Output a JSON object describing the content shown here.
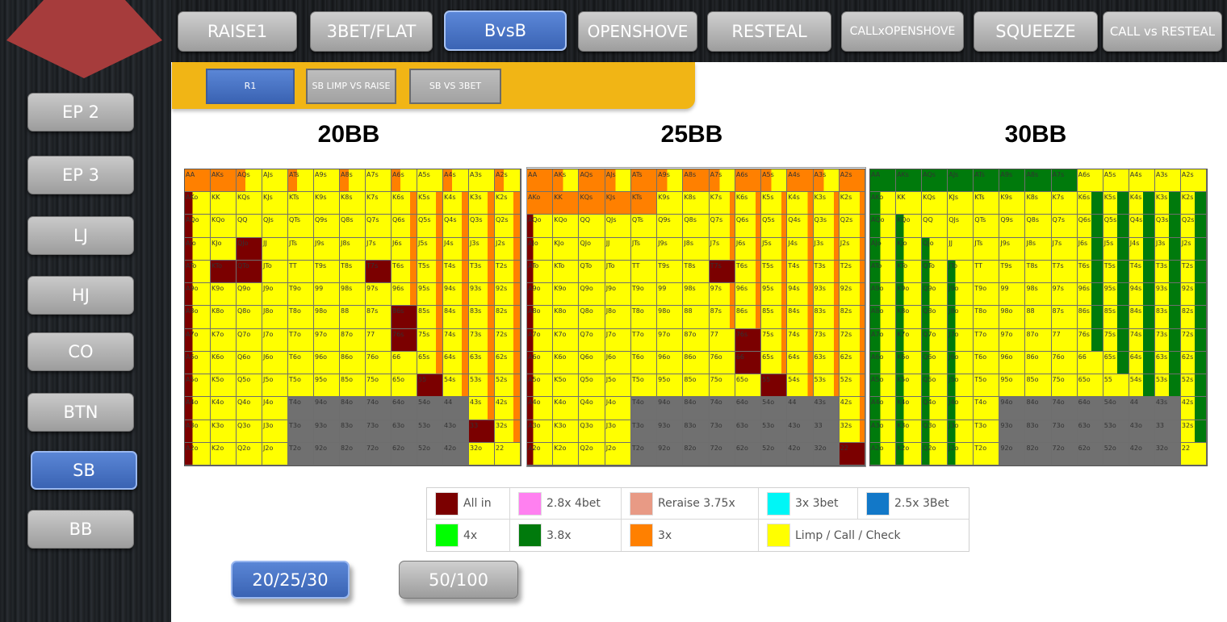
{
  "colors": {
    "all_in": "#7b0000",
    "four_bet": "#ff80f0",
    "reraise": "#e89a85",
    "three_bet_3x": "#00f6f6",
    "three_bet_25": "#1278c8",
    "raise_4x": "#00ff00",
    "raise_38x": "#007a0c",
    "raise_3x": "#ff8000",
    "limp": "#ffff00",
    "fold": "#707070"
  },
  "sidebar": {
    "logo_icon": "red-pentagon-logo",
    "positions": [
      {
        "label": "EP 2",
        "active": false
      },
      {
        "label": "EP 3",
        "active": false
      },
      {
        "label": "LJ",
        "active": false
      },
      {
        "label": "HJ",
        "active": false
      },
      {
        "label": "CO",
        "active": false
      },
      {
        "label": "BTN",
        "active": false
      },
      {
        "label": "SB",
        "active": true
      },
      {
        "label": "BB",
        "active": false
      }
    ]
  },
  "tabs": [
    {
      "label": "RAISE1",
      "active": false
    },
    {
      "label": "3BET/FLAT",
      "active": false
    },
    {
      "label": "BvsB",
      "active": true
    },
    {
      "label": "OPENSHOVE",
      "active": false
    },
    {
      "label": "RESTEAL",
      "active": false
    },
    {
      "label": "CALLxOPENSHOVE",
      "active": false
    },
    {
      "label": "SQUEEZE",
      "active": false
    },
    {
      "label": "CALL vs RESTEAL",
      "active": false
    }
  ],
  "subtabs": [
    {
      "label": "R1",
      "active": true
    },
    {
      "label": "SB LIMP VS RAISE",
      "active": false
    },
    {
      "label": "SB VS 3BET",
      "active": false
    }
  ],
  "ranks": [
    "A",
    "K",
    "Q",
    "J",
    "T",
    "9",
    "8",
    "7",
    "6",
    "5",
    "4",
    "3",
    "2"
  ],
  "charts": [
    {
      "title": "20BB"
    },
    {
      "title": "25BB"
    },
    {
      "title": "30BB"
    }
  ],
  "legend": {
    "row1": [
      {
        "label": "All in",
        "color": "#7b0000"
      },
      {
        "label": "2.8x 4bet",
        "color": "#ff80f0"
      },
      {
        "label": "Reraise 3.75x",
        "color": "#e89a85"
      },
      {
        "label": "3x 3bet",
        "color": "#00f6f6"
      },
      {
        "label": "2.5x 3Bet",
        "color": "#1278c8"
      }
    ],
    "row2": [
      {
        "label": "4x",
        "color": "#00ff00"
      },
      {
        "label": "3.8x",
        "color": "#007a0c"
      },
      {
        "label": "3x",
        "color": "#ff8000"
      },
      {
        "label": "Limp / Call / Check",
        "color": "#ffff00"
      }
    ]
  },
  "bottom_buttons": [
    {
      "label": "20/25/30",
      "active": true
    },
    {
      "label": "50/100",
      "active": false
    }
  ]
}
